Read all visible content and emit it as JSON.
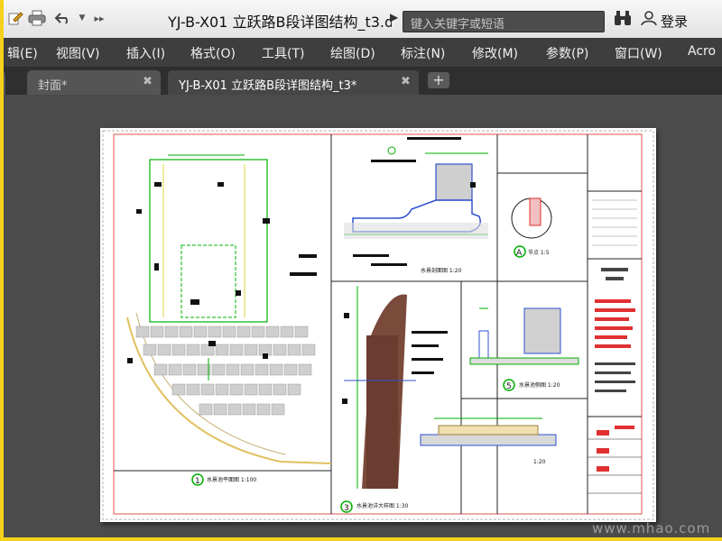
{
  "titlebar": {
    "doc_title": "YJ-B-X01 立跃路B段详图结构_t3.d...",
    "search_placeholder": "键入关键字或短语",
    "login_label": "登录",
    "icons": [
      "edit-icon",
      "print-icon",
      "undo-icon",
      "dropdown-icon",
      "more-icon",
      "binoculars-icon",
      "user-icon"
    ]
  },
  "menu": {
    "items": [
      "辑(E)",
      "视图(V)",
      "插入(I)",
      "格式(O)",
      "工具(T)",
      "绘图(D)",
      "标注(N)",
      "修改(M)",
      "参数(P)",
      "窗口(W)",
      "Acro"
    ]
  },
  "tabs": [
    {
      "label": "封面*",
      "active": false
    },
    {
      "label": "YJ-B-X01 立跃路B段详图结构_t3*",
      "active": true
    }
  ],
  "drawing": {
    "details": [
      {
        "num": "1",
        "caption": "水景池平面图  1:100"
      },
      {
        "num": "A",
        "caption": "节点  1:5"
      },
      {
        "num": "3",
        "caption": "水景池详大样图  1:30"
      },
      {
        "num": "5",
        "caption": "水景池侧图  1:20"
      },
      {
        "num": "",
        "caption": "水景剖面图  1:20"
      },
      {
        "num": "",
        "caption": "1:20"
      }
    ]
  },
  "watermark": "www.mhao.com",
  "colors": {
    "menubar": "#3e3e3e",
    "canvas": "#4b4b4b",
    "frame": "#f4d21b",
    "cad_green": "#00c000",
    "cad_red": "#e03030"
  }
}
